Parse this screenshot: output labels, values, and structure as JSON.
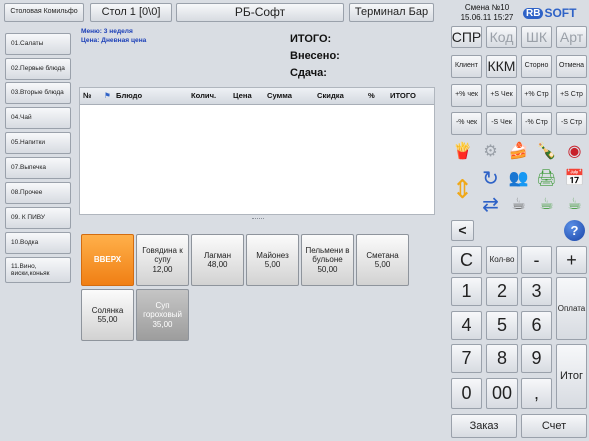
{
  "topbar": {
    "venue": "Столовая Комильфо",
    "table": "Стол 1 [0\\0]",
    "app": "РБ-Софт",
    "terminal": "Терминал Бар",
    "shift": "Смена №10",
    "datetime": "15.06.11 15:27",
    "logo": "RBSOFT"
  },
  "categories": [
    "01.Салаты",
    "02.Первые блюда",
    "03.Вторые блюда",
    "04.Чай",
    "05.Напитки",
    "07.Выпечка",
    "08.Прочее",
    "09. К ПИВУ",
    "10.Водка",
    "11.Вино, виски,коньяк"
  ],
  "info": {
    "menu": "Меню: 3 неделя",
    "price": "Цена: Дневная цена",
    "total_label": "ИТОГО:",
    "paid_label": "Внесено:",
    "change_label": "Сдача:"
  },
  "table": {
    "columns": [
      "№",
      "Блюдо",
      "Колич.",
      "Цена",
      "Сумма",
      "Скидка",
      "%",
      "ИТОГО"
    ]
  },
  "dishes": [
    {
      "name": "ВВЕРХ",
      "price": ""
    },
    {
      "name": "Говядина к супу",
      "price": "12,00"
    },
    {
      "name": "Лагман",
      "price": "48,00"
    },
    {
      "name": "Майонез",
      "price": "5,00"
    },
    {
      "name": "Пельмени в бульоне",
      "price": "50,00"
    },
    {
      "name": "Сметана",
      "price": "5,00"
    },
    {
      "name": "Солянка",
      "price": "55,00"
    },
    {
      "name": "Суп гороховый",
      "price": "35,00"
    }
  ],
  "right": {
    "spr": "СПР",
    "kod": "Код",
    "shk": "ШК",
    "art": "Арт",
    "client": "Клиент",
    "kkm": "ККМ",
    "storno": "Сторно",
    "otmena": "Отмена",
    "pct_check_plus": "+% чек",
    "s_check_plus": "+S Чек",
    "pct_str_plus": "+% Стр",
    "s_str_plus": "+S Стр",
    "pct_check_minus": "-% чек",
    "s_check_minus": "-S Чек",
    "pct_str_minus": "-% Стр",
    "s_str_minus": "-S Стр",
    "back": "<",
    "help": "?",
    "c": "C",
    "qty": "Кол-во",
    "minus": "-",
    "plus": "+",
    "d1": "1",
    "d2": "2",
    "d3": "3",
    "d4": "4",
    "d5": "5",
    "d6": "6",
    "d7": "7",
    "d8": "8",
    "d9": "9",
    "d0": "0",
    "d00": "00",
    "comma": ",",
    "pay": "Оплата",
    "itog": "Итог",
    "order": "Заказ",
    "bill": "Счет"
  },
  "icons": [
    "fries-icon",
    "gear-icon",
    "cake-icon",
    "bottle-icon",
    "globe-icon",
    "arrows-updown-icon",
    "refresh-icon",
    "users-icon",
    "printer-icon",
    "calendar-icon",
    "arrows-swap-icon",
    "cup-icon",
    "cup-check-icon",
    "cup-ok-icon"
  ],
  "colors": {
    "accent_blue": "#1b3fb8",
    "orange": "#f07f14",
    "logo_blue": "#2e62c7"
  }
}
